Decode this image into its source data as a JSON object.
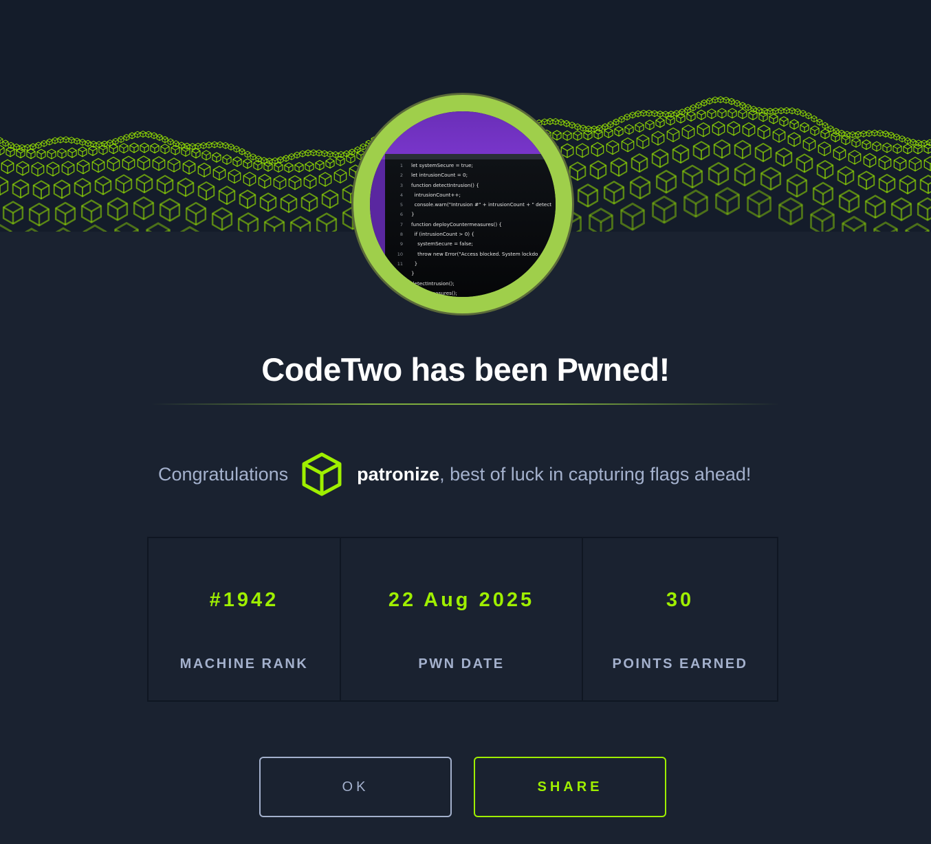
{
  "banner": {
    "accent_color": "#9fef00",
    "avatar_code_lines": [
      {
        "n": "1",
        "code": "let systemSecure = true;"
      },
      {
        "n": "2",
        "code": "let intrusionCount = 0;"
      },
      {
        "n": "3",
        "code": "function detectIntrusion() {"
      },
      {
        "n": "4",
        "code": "  intrusionCount++;"
      },
      {
        "n": "5",
        "code": "  console.warn(\"Intrusion #\" + intrusionCount + \" detect"
      },
      {
        "n": "6",
        "code": "}"
      },
      {
        "n": "7",
        "code": "function deployCountermeasures() {"
      },
      {
        "n": "8",
        "code": "  if (intrusionCount > 0) {"
      },
      {
        "n": "9",
        "code": "    systemSecure = false;"
      },
      {
        "n": "10",
        "code": "    throw new Error(\"Access blocked. System lockdo"
      },
      {
        "n": "11",
        "code": "  }"
      },
      {
        "n": "",
        "code": "}"
      },
      {
        "n": "",
        "code": "detectIntrusion();"
      },
      {
        "n": "",
        "code": "    ntermeasures();"
      }
    ]
  },
  "dialog": {
    "title": "CodeTwo has been Pwned!",
    "congrats_prefix": "Congratulations",
    "username": "patronize",
    "congrats_suffix": ", best of luck in capturing flags ahead!",
    "user_icon": "hexagon-cube-icon"
  },
  "stats": [
    {
      "value": "#1942",
      "label": "MACHINE RANK"
    },
    {
      "value": "22 Aug 2025",
      "label": "PWN DATE"
    },
    {
      "value": "30",
      "label": "POINTS EARNED"
    }
  ],
  "buttons": {
    "ok_label": "OK",
    "share_label": "SHARE"
  },
  "colors": {
    "background": "#1a2230",
    "accent": "#9fef00",
    "muted_text": "#a4b1cd"
  }
}
